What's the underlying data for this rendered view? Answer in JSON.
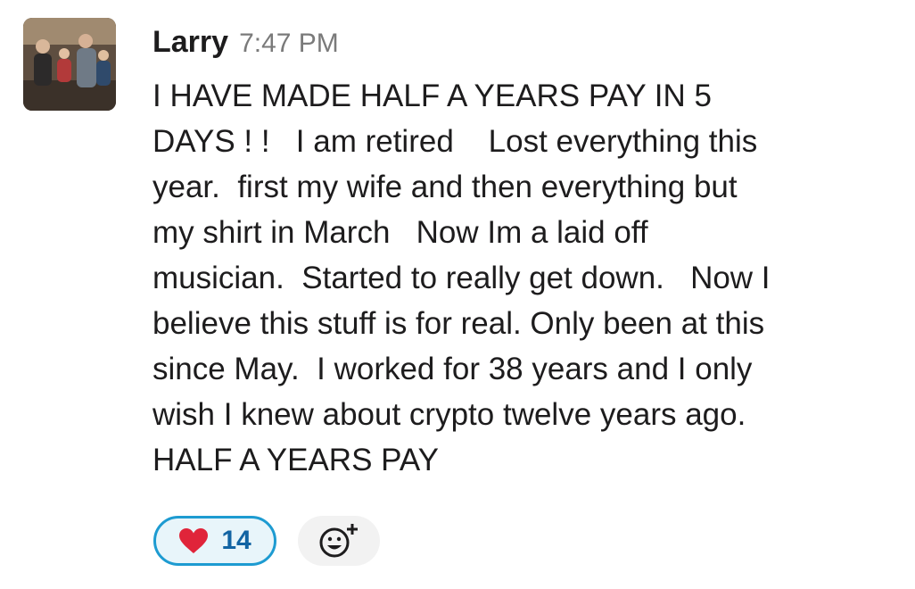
{
  "message": {
    "author": "Larry",
    "timestamp": "7:47 PM",
    "avatar_icon": "user-photo-avatar",
    "lines": [
      "I HAVE MADE HALF A YEARS PAY IN 5",
      "DAYS ! !   I am retired    Lost everything this",
      "year.  first my wife and then everything but",
      "my shirt in March   Now Im a laid off",
      "musician.  Started to really get down.   Now I",
      "believe this stuff is for real. Only been at this",
      "since May.  I worked for 38 years and I only",
      "wish I knew about crypto twelve years ago.",
      "HALF A YEARS PAY"
    ]
  },
  "reactions": [
    {
      "icon": "heart-icon",
      "count": "14",
      "color": "#e0243a"
    }
  ],
  "add_reaction": {
    "icon": "add-emoji-icon"
  },
  "colors": {
    "reaction_border": "#1d9bd1",
    "reaction_bg": "#e8f5fa",
    "reaction_count": "#1264a3",
    "timestamp": "#7a7a7a"
  }
}
